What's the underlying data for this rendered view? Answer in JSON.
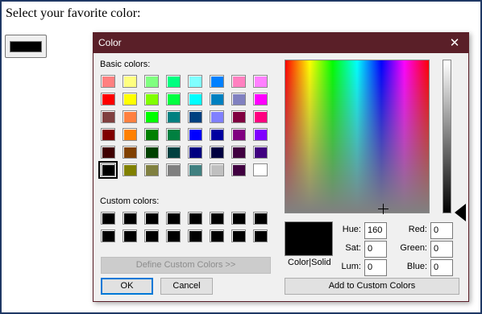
{
  "page": {
    "prompt": "Select your favorite color:",
    "selected_color": "#000000"
  },
  "dialog": {
    "title": "Color",
    "close_icon": "close-icon",
    "basic_colors_label": "Basic colors:",
    "basic_colors": [
      [
        "#ff8080",
        "#ffff80",
        "#80ff80",
        "#00ff80",
        "#80ffff",
        "#0080ff",
        "#ff80c0",
        "#ff80ff"
      ],
      [
        "#ff0000",
        "#ffff00",
        "#80ff00",
        "#00ff40",
        "#00ffff",
        "#0080c0",
        "#8080c0",
        "#ff00ff"
      ],
      [
        "#804040",
        "#ff8040",
        "#00ff00",
        "#008080",
        "#004080",
        "#8080ff",
        "#800040",
        "#ff0080"
      ],
      [
        "#800000",
        "#ff8000",
        "#008000",
        "#008040",
        "#0000ff",
        "#0000a0",
        "#800080",
        "#8000ff"
      ],
      [
        "#400000",
        "#804000",
        "#004000",
        "#004040",
        "#000080",
        "#000040",
        "#400040",
        "#400080"
      ],
      [
        "#000000",
        "#808000",
        "#808040",
        "#808080",
        "#408080",
        "#c0c0c0",
        "#400040",
        "#ffffff"
      ]
    ],
    "custom_colors_label": "Custom colors:",
    "custom_colors": [
      [
        "#000000",
        "#000000",
        "#000000",
        "#000000",
        "#000000",
        "#000000",
        "#000000",
        "#000000"
      ],
      [
        "#000000",
        "#000000",
        "#000000",
        "#000000",
        "#000000",
        "#000000",
        "#000000",
        "#000000"
      ]
    ],
    "define_custom_label": "Define Custom Colors >>",
    "ok_label": "OK",
    "cancel_label": "Cancel",
    "color_solid_label": "Color|Solid",
    "add_custom_label": "Add to Custom Colors",
    "fields": {
      "hue": {
        "label": "Hue:",
        "value": "160"
      },
      "sat": {
        "label": "Sat:",
        "value": "0"
      },
      "lum": {
        "label": "Lum:",
        "value": "0"
      },
      "red": {
        "label": "Red:",
        "value": "0"
      },
      "green": {
        "label": "Green:",
        "value": "0"
      },
      "blue": {
        "label": "Blue:",
        "value": "0"
      }
    }
  }
}
